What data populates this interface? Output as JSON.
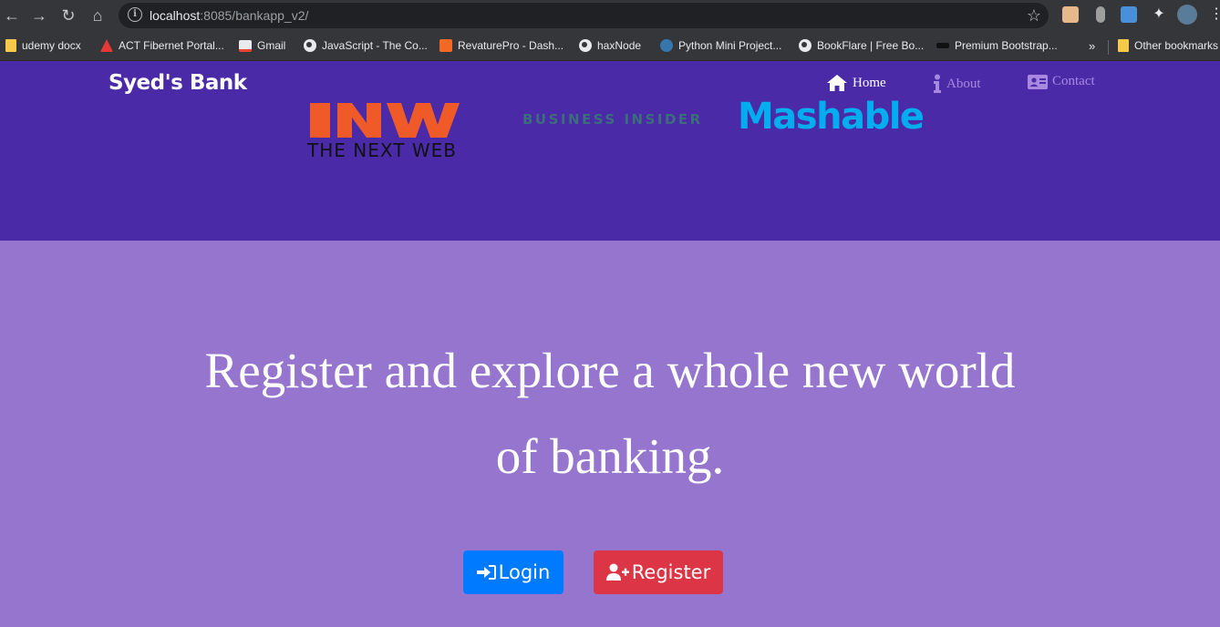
{
  "browser": {
    "url_host": "localhost",
    "url_path": ":8085/bankapp_v2/",
    "bookmarks": [
      {
        "label": "udemy docx",
        "icon": "folder-icon"
      },
      {
        "label": "ACT Fibernet Portal...",
        "icon": "act-icon"
      },
      {
        "label": "Gmail",
        "icon": "gmail-icon"
      },
      {
        "label": "JavaScript - The Co...",
        "icon": "globe-icon"
      },
      {
        "label": "RevaturePro - Dash...",
        "icon": "revature-icon"
      },
      {
        "label": "haxNode",
        "icon": "globe-icon"
      },
      {
        "label": "Python Mini Project...",
        "icon": "python-icon"
      },
      {
        "label": "BookFlare | Free Bo...",
        "icon": "globe-icon"
      },
      {
        "label": "Premium Bootstrap...",
        "icon": "bootstrap-icon"
      }
    ],
    "more_label": "»",
    "other_bookmarks": "Other bookmarks"
  },
  "site": {
    "brand": "Syed's Bank",
    "nav": [
      {
        "label": "Home",
        "icon": "home-icon",
        "active": true
      },
      {
        "label": "About",
        "icon": "info-icon",
        "active": false
      },
      {
        "label": "Contact",
        "icon": "contact-card-icon",
        "active": false
      }
    ],
    "logos": {
      "tnw_caption": "THE NEXT WEB",
      "business_insider": "BUSINESS INSIDER",
      "mashable": "Mashable"
    },
    "headline_line1": "Register and explore a whole new world",
    "headline_line2": "of banking.",
    "login_label": "Login",
    "register_label": "Register"
  },
  "colors": {
    "navbar": "#4b2aa8",
    "hero": "#9575cd",
    "login": "#007bff",
    "register": "#dc3545",
    "mashable": "#00aeef",
    "tnw": "#f05a28"
  }
}
